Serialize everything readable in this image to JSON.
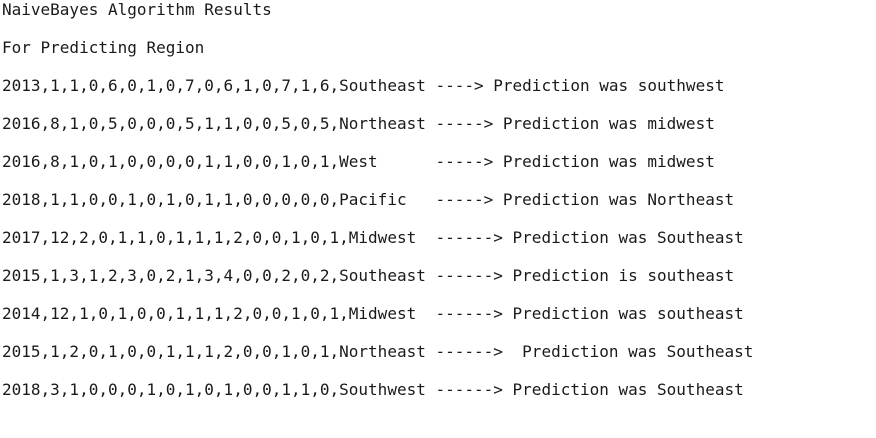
{
  "title": "NaiveBayes Algorithm Results",
  "subtitle": "For Predicting Region",
  "results": [
    "2013,1,1,0,6,0,1,0,7,0,6,1,0,7,1,6,Southeast ----> Prediction was southwest",
    "2016,8,1,0,5,0,0,0,5,1,1,0,0,5,0,5,Northeast -----> Prediction was midwest",
    "2016,8,1,0,1,0,0,0,0,1,1,0,0,1,0,1,West      -----> Prediction was midwest",
    "2018,1,1,0,0,1,0,1,0,1,1,0,0,0,0,0,Pacific   -----> Prediction was Northeast",
    "2017,12,2,0,1,1,0,1,1,1,2,0,0,1,0,1,Midwest  ------> Prediction was Southeast",
    "2015,1,3,1,2,3,0,2,1,3,4,0,0,2,0,2,Southeast ------> Prediction is southeast",
    "2014,12,1,0,1,0,0,1,1,1,2,0,0,1,0,1,Midwest  ------> Prediction was southeast",
    "2015,1,2,0,1,0,0,1,1,1,2,0,0,1,0,1,Northeast ------>  Prediction was Southeast",
    "2018,3,1,0,0,0,1,0,1,0,1,0,0,1,1,0,Southwest ------> Prediction was Southeast"
  ]
}
